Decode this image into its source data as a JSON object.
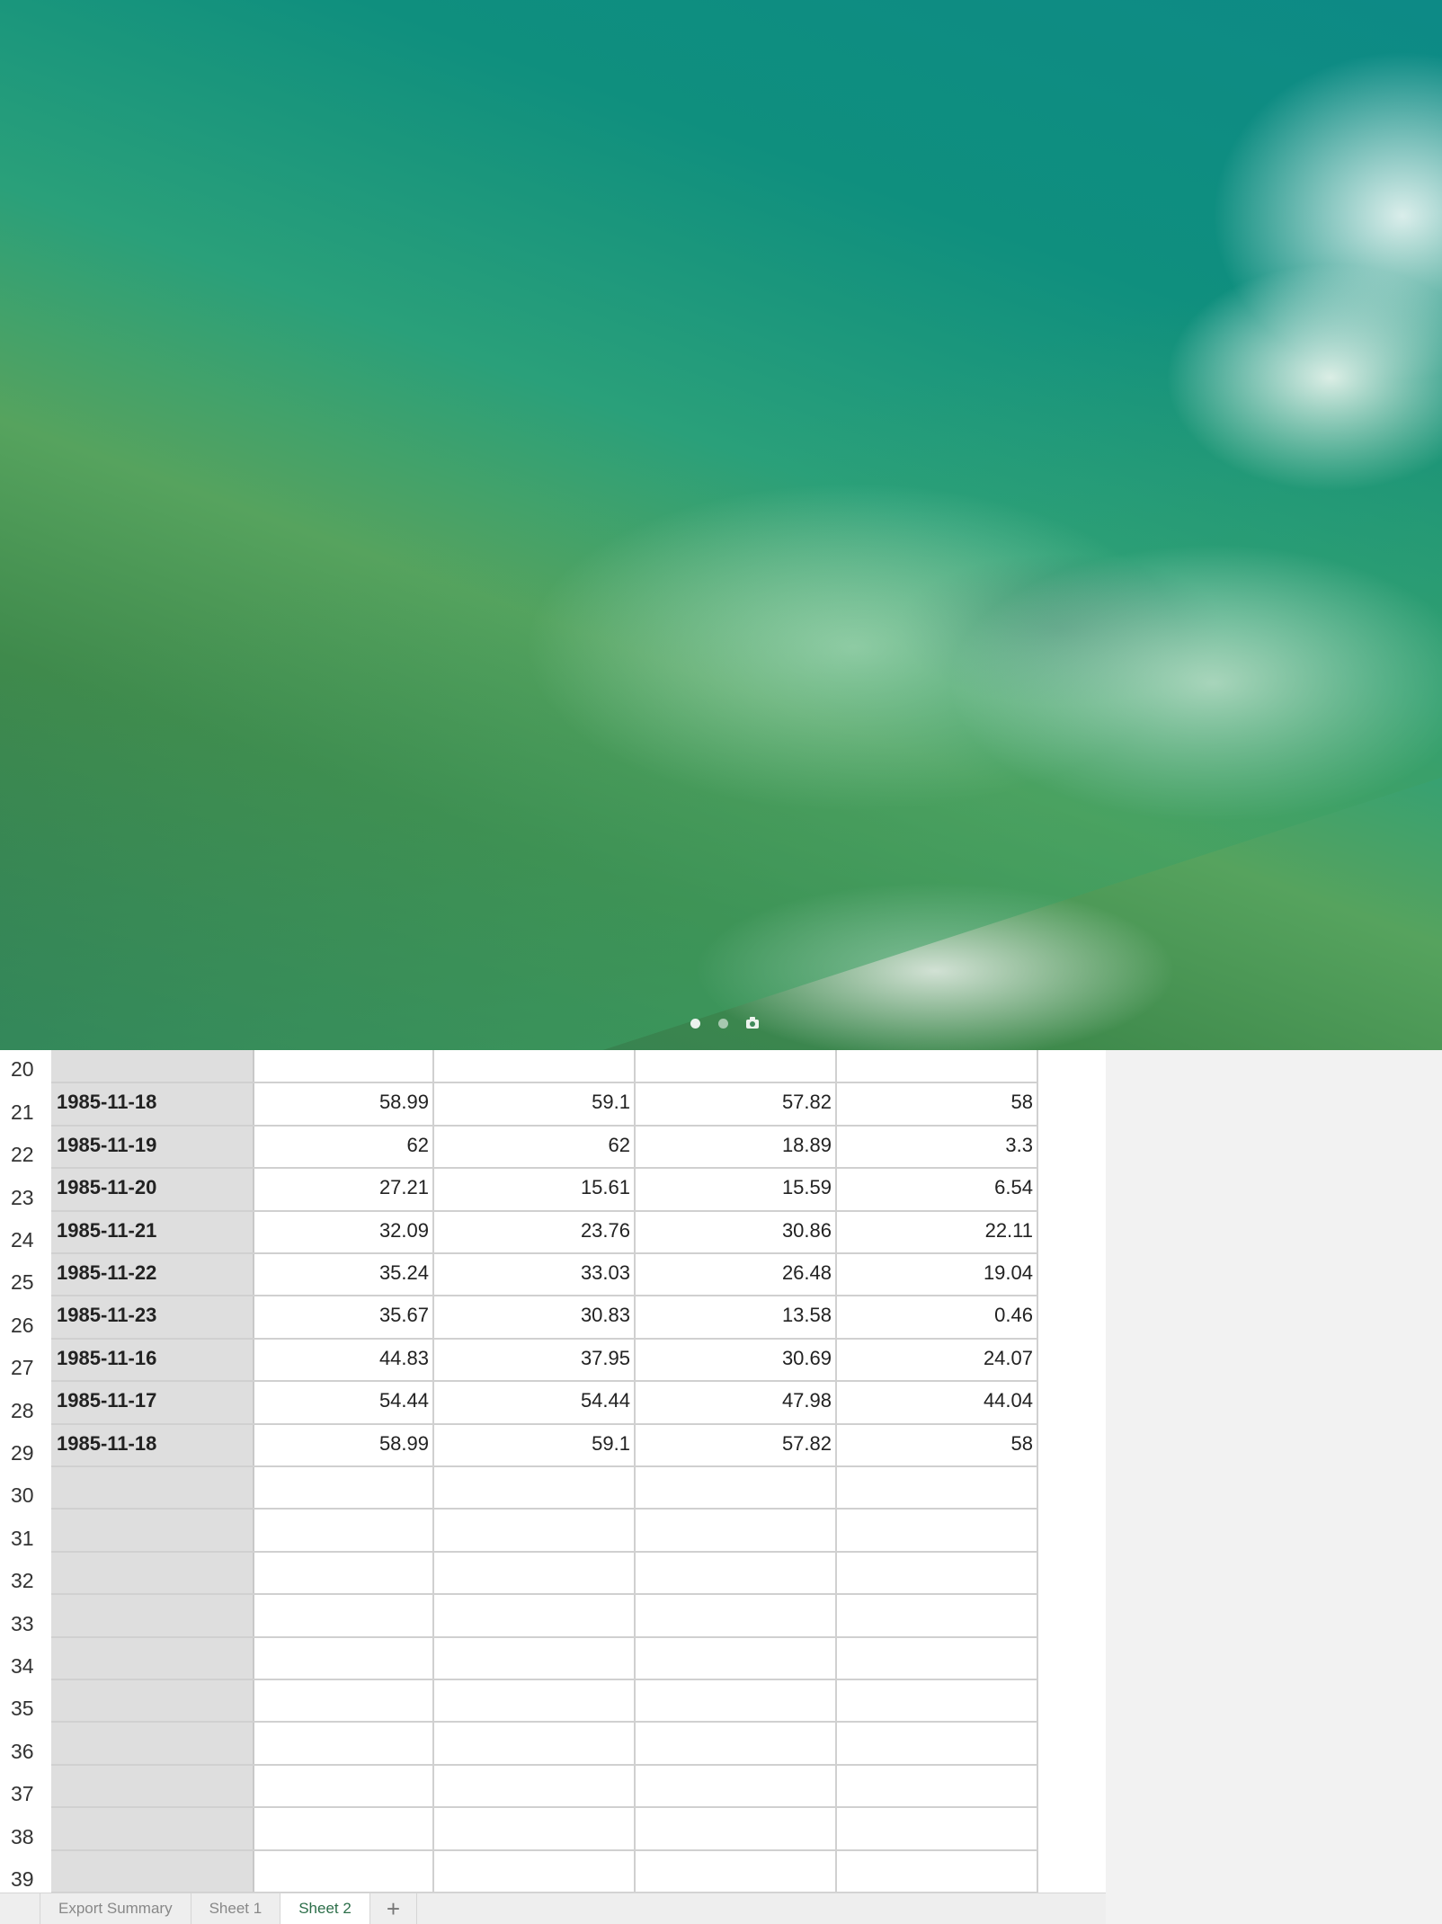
{
  "lock_screen": {
    "page_indicator": {
      "dots": 2,
      "camera_icon": "camera-icon"
    }
  },
  "spreadsheet": {
    "rows": [
      {
        "n": "20",
        "date": "",
        "v": [
          "",
          "",
          "",
          ""
        ]
      },
      {
        "n": "21",
        "date": "1985-11-18",
        "v": [
          "58.99",
          "59.1",
          "57.82",
          "58"
        ]
      },
      {
        "n": "22",
        "date": "1985-11-19",
        "v": [
          "62",
          "62",
          "18.89",
          "3.3"
        ]
      },
      {
        "n": "23",
        "date": "1985-11-20",
        "v": [
          "27.21",
          "15.61",
          "15.59",
          "6.54"
        ]
      },
      {
        "n": "24",
        "date": "1985-11-21",
        "v": [
          "32.09",
          "23.76",
          "30.86",
          "22.11"
        ]
      },
      {
        "n": "25",
        "date": "1985-11-22",
        "v": [
          "35.24",
          "33.03",
          "26.48",
          "19.04"
        ]
      },
      {
        "n": "26",
        "date": "1985-11-23",
        "v": [
          "35.67",
          "30.83",
          "13.58",
          "0.46"
        ]
      },
      {
        "n": "27",
        "date": "1985-11-16",
        "v": [
          "44.83",
          "37.95",
          "30.69",
          "24.07"
        ]
      },
      {
        "n": "28",
        "date": "1985-11-17",
        "v": [
          "54.44",
          "54.44",
          "47.98",
          "44.04"
        ]
      },
      {
        "n": "29",
        "date": "1985-11-18",
        "v": [
          "58.99",
          "59.1",
          "57.82",
          "58"
        ]
      },
      {
        "n": "30",
        "date": "",
        "v": [
          "",
          "",
          "",
          ""
        ]
      },
      {
        "n": "31",
        "date": "",
        "v": [
          "",
          "",
          "",
          ""
        ]
      },
      {
        "n": "32",
        "date": "",
        "v": [
          "",
          "",
          "",
          ""
        ]
      },
      {
        "n": "33",
        "date": "",
        "v": [
          "",
          "",
          "",
          ""
        ]
      },
      {
        "n": "34",
        "date": "",
        "v": [
          "",
          "",
          "",
          ""
        ]
      },
      {
        "n": "35",
        "date": "",
        "v": [
          "",
          "",
          "",
          ""
        ]
      },
      {
        "n": "36",
        "date": "",
        "v": [
          "",
          "",
          "",
          ""
        ]
      },
      {
        "n": "37",
        "date": "",
        "v": [
          "",
          "",
          "",
          ""
        ]
      },
      {
        "n": "38",
        "date": "",
        "v": [
          "",
          "",
          "",
          ""
        ]
      },
      {
        "n": "39",
        "date": "",
        "v": [
          "",
          "",
          "",
          ""
        ]
      }
    ]
  },
  "tabs": {
    "items": [
      "Export Summary",
      "Sheet 1",
      "Sheet 2"
    ],
    "active": "Sheet 2",
    "add_label": "+"
  }
}
